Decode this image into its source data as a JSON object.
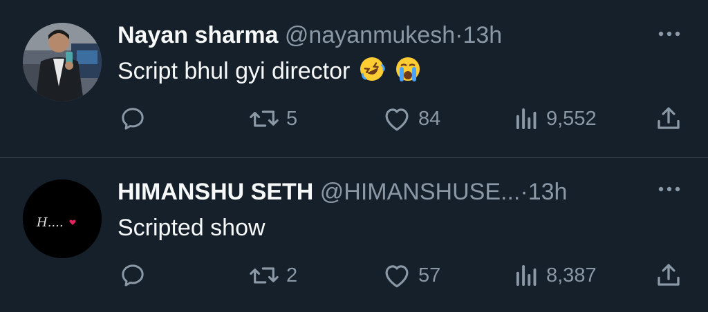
{
  "tweets": [
    {
      "name": "Nayan sharma",
      "handle": "@nayanmukesh",
      "separator": "·",
      "time": "13h",
      "text": "Script bhul gyi director",
      "emojis": [
        "rolling-on-floor-laughing-emoji",
        "loudly-crying-emoji"
      ],
      "retweets": "5",
      "likes": "84",
      "views": "9,552",
      "avatar": "profile-photo"
    },
    {
      "name": "HIMANSHU SETH",
      "handle": "@HIMANSHUSE...",
      "separator": "·",
      "time": "13h",
      "text": "Scripted show",
      "retweets": "2",
      "likes": "57",
      "views": "8,387",
      "avatar_text": "H....",
      "avatar": "black-avatar-with-heart"
    }
  ],
  "colors": {
    "background": "#15202b",
    "text_primary": "#f7f9f9",
    "text_secondary": "#8b98a5",
    "divider": "#38444d",
    "heart_red": "#e0245e"
  },
  "icons": [
    "reply-icon",
    "retweet-icon",
    "like-icon",
    "views-icon",
    "share-icon",
    "more-icon"
  ]
}
